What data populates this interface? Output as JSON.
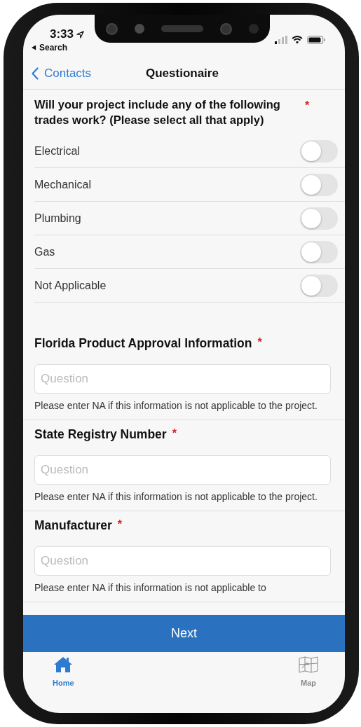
{
  "status_bar": {
    "time": "3:33",
    "back_app": "Search"
  },
  "nav": {
    "back": "Contacts",
    "title": "Questionaire"
  },
  "question": {
    "text": "Will your project include any of the following trades work? (Please select all that apply)",
    "required_mark": "*"
  },
  "options": [
    {
      "label": "Electrical",
      "on": false
    },
    {
      "label": "Mechanical",
      "on": false
    },
    {
      "label": "Plumbing",
      "on": false
    },
    {
      "label": "Gas",
      "on": false
    },
    {
      "label": "Not Applicable",
      "on": false
    }
  ],
  "sections": [
    {
      "title": "Florida Product Approval Information",
      "required_mark": "*",
      "placeholder": "Question",
      "help": "Please enter NA if this information is not applicable to the project."
    },
    {
      "title": "State Registry Number",
      "required_mark": "*",
      "placeholder": "Question",
      "help": "Please enter NA if this information is not applicable to the project."
    },
    {
      "title": "Manufacturer",
      "required_mark": "*",
      "placeholder": "Question",
      "help": "Please enter NA if this information is not applicable to"
    }
  ],
  "next_button": "Next",
  "tabs": [
    {
      "label": "Home",
      "kind": "home",
      "selected": true
    },
    {
      "label": "Map",
      "kind": "map",
      "selected": false
    }
  ]
}
